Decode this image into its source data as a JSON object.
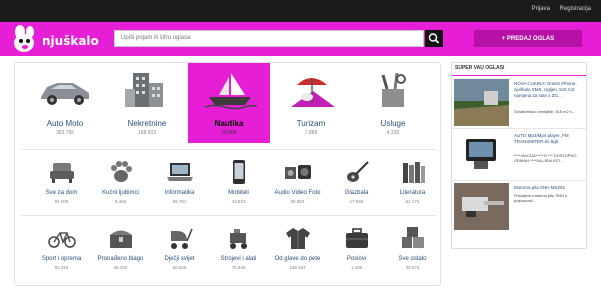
{
  "topbar": {
    "login": "Prijava",
    "register": "Registracija"
  },
  "header": {
    "logo_text": "njuškalo",
    "search_placeholder": "Upiši pojam ili šifru oglasa",
    "post_button": "+ PREDAJ OGLAS",
    "brand_color": "#e61fd6"
  },
  "main": {
    "big_categories": [
      {
        "name": "Auto Moto",
        "count": "363.765",
        "icon": "car-icon"
      },
      {
        "name": "Nekretnine",
        "count": "168.503",
        "icon": "buildings-icon"
      },
      {
        "name": "Nautika",
        "count": "10.904",
        "icon": "boat-icon"
      },
      {
        "name": "Turizam",
        "count": "7.888",
        "icon": "beach-umbrella-icon"
      },
      {
        "name": "Usluge",
        "count": "4.330",
        "icon": "tools-icon"
      }
    ],
    "small_row1": [
      {
        "name": "Sve za dom",
        "count": "84.009",
        "icon": "armchair-icon"
      },
      {
        "name": "Kućni ljubimci",
        "count": "8.466",
        "icon": "paw-icon"
      },
      {
        "name": "Informatika",
        "count": "65.751",
        "icon": "laptop-icon"
      },
      {
        "name": "Mobiteli",
        "count": "43.823",
        "icon": "phone-icon"
      },
      {
        "name": "Audio Video Foto",
        "count": "55.883",
        "icon": "audio-video-icon"
      },
      {
        "name": "Glazbala",
        "count": "17.659",
        "icon": "guitar-icon"
      },
      {
        "name": "Literatura",
        "count": "52.172",
        "icon": "books-icon"
      }
    ],
    "small_row2": [
      {
        "name": "Sport i oprema",
        "count": "50.319",
        "icon": "bicycle-icon"
      },
      {
        "name": "Pronađeno blago",
        "count": "55.330",
        "icon": "treasure-chest-icon"
      },
      {
        "name": "Dječji svijet",
        "count": "50.626",
        "icon": "stroller-icon"
      },
      {
        "name": "Strojevi i alati",
        "count": "75.849",
        "icon": "machine-icon"
      },
      {
        "name": "Od glave do pete",
        "count": "169.464",
        "icon": "jacket-icon"
      },
      {
        "name": "Poslovi",
        "count": "1.438",
        "icon": "briefcase-icon"
      },
      {
        "name": "Sve ostalo",
        "count": "30.873",
        "icon": "boxes-icon"
      }
    ]
  },
  "sidebar": {
    "title": "SUPER VAU OGLASI",
    "ads": [
      {
        "title": "NOVA CUKINA! Gratis! iPhone, njuškalo SMS, Ugljen, 515 m2 namjena za stan s ZG...",
        "desc": "Građevinsko zemljište, 515 m2 s..."
      },
      {
        "title": "AUTO Mp3/Mp4 player, FM TRANSMITER do 8gb",
        "desc": "*****AKCIJA*****!!! *** DOSTUPNO ODMAH ****SALJEM ISTI..."
      },
      {
        "title": "Motorna pila SNH MS291",
        "desc": "Prodajem motornu pilu SNH u potpunosti..."
      }
    ]
  }
}
